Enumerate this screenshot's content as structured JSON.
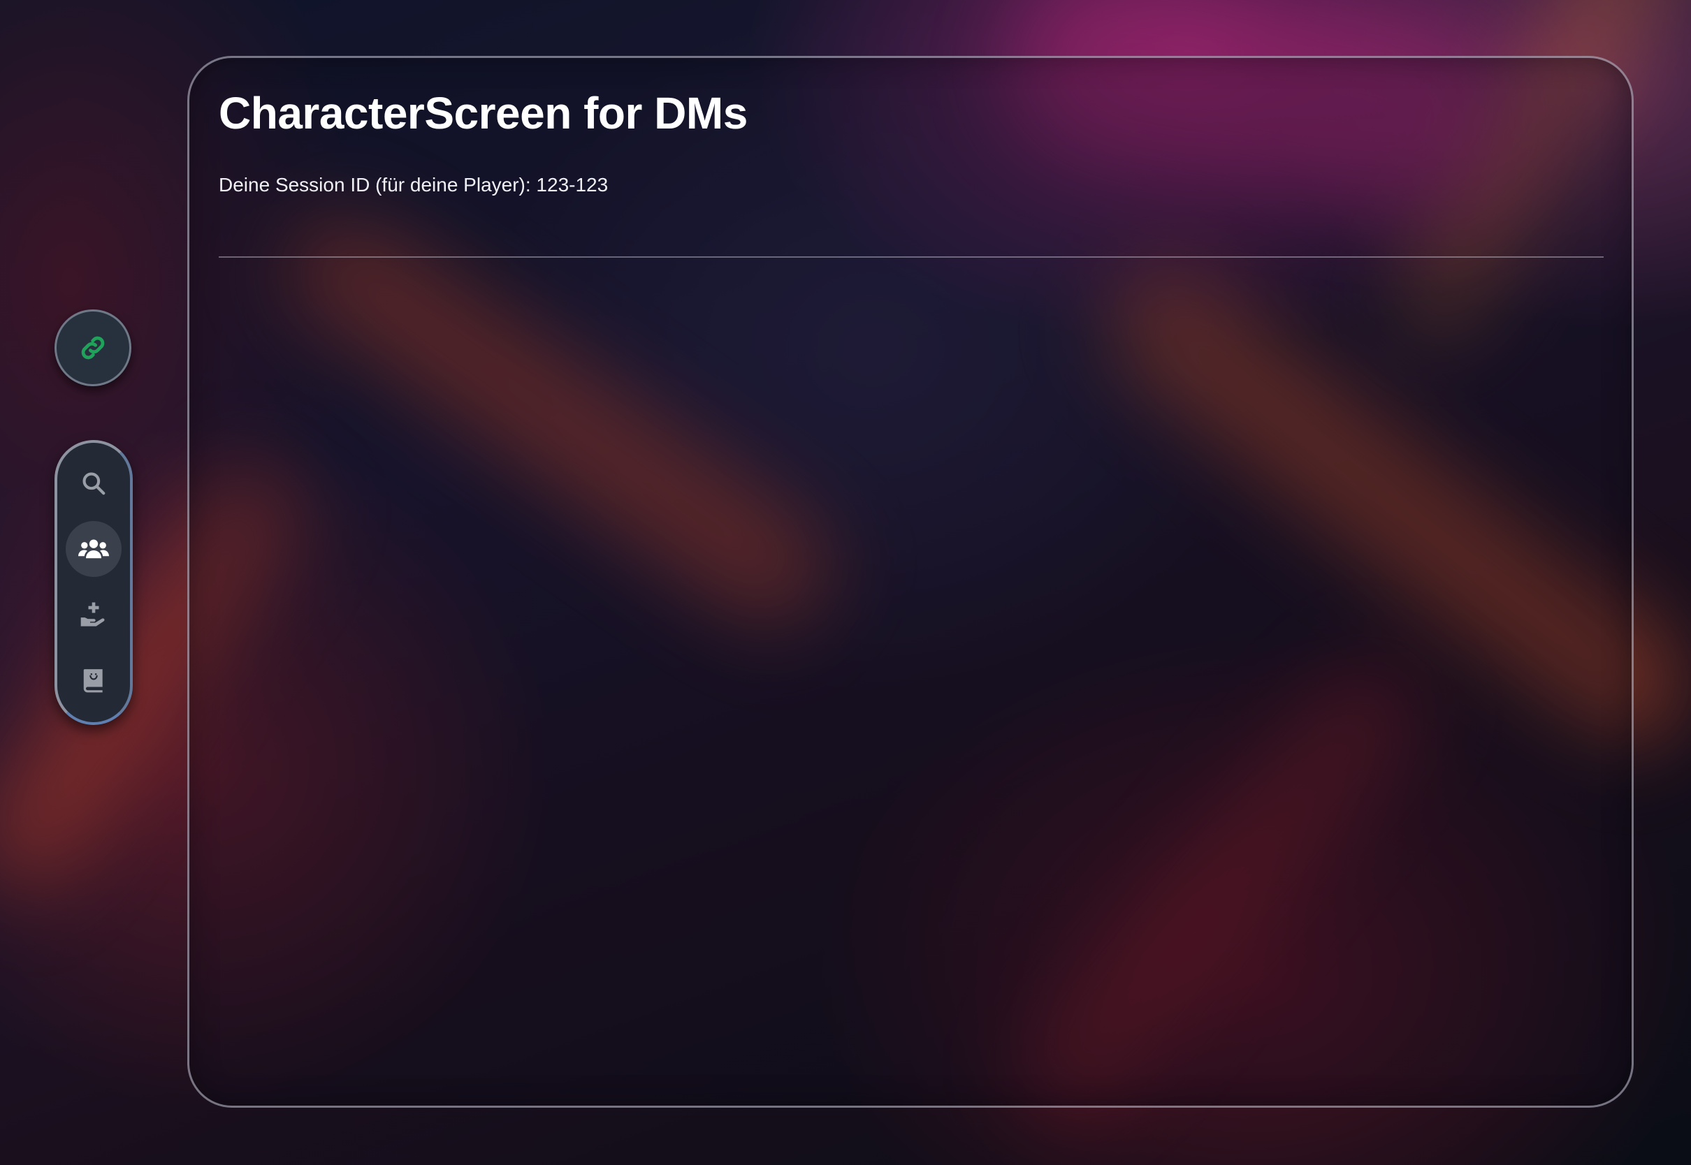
{
  "header": {
    "title": "CharacterScreen for DMs",
    "session_text": "Deine Session ID (für deine Player): 123-123"
  },
  "sidebar": {
    "link_button": {
      "icon": "link-icon",
      "color": "#1fa35a"
    },
    "nav_items": [
      {
        "icon": "search-icon",
        "active": false
      },
      {
        "icon": "users-icon",
        "active": true
      },
      {
        "icon": "hand-holding-medical-icon",
        "active": false
      },
      {
        "icon": "book-icon",
        "active": false
      }
    ]
  },
  "colors": {
    "text": "#ffffff",
    "icon_inactive": "#9a9ea6",
    "icon_active": "#ffffff",
    "accent_green": "#1fa35a"
  }
}
